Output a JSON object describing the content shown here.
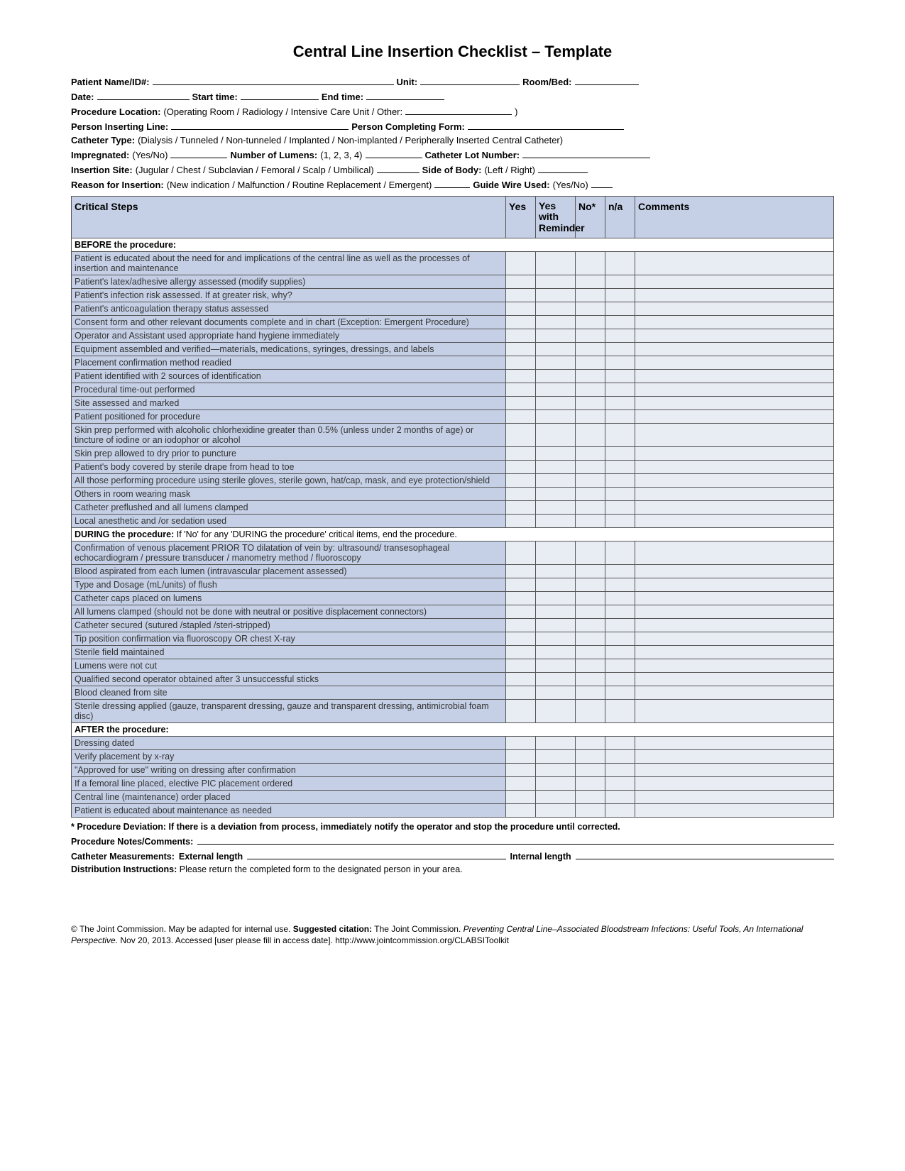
{
  "title": "Central Line Insertion Checklist – Template",
  "info": {
    "patient": "Patient Name/ID#:",
    "unit": "Unit:",
    "roombed": "Room/Bed:",
    "date": "Date:",
    "start": "Start time:",
    "end": "End time:",
    "procloc_label": "Procedure Location:",
    "procloc_paren": "(Operating Room / Radiology / Intensive Care Unit / Other:",
    "procloc_close": ")",
    "person_insert": "Person Inserting Line:",
    "person_form": "Person Completing Form:",
    "cath_type_label": "Catheter Type:",
    "cath_type_paren": "(Dialysis / Tunneled / Non-tunneled / Implanted / Non-implanted / Peripherally Inserted Central Catheter)",
    "impreg_label": "Impregnated:",
    "impreg_paren": "(Yes/No)",
    "numlumens_label": "Number of Lumens:",
    "numlumens_paren": "(1, 2, 3, 4)",
    "lot_label": "Catheter Lot Number:",
    "site_label": "Insertion Site:",
    "site_paren": "(Jugular / Chest / Subclavian / Femoral / Scalp / Umbilical)",
    "side_label": "Side of Body:",
    "side_paren": "(Left / Right)",
    "reason_label": "Reason for Insertion:",
    "reason_paren": "(New indication / Malfunction / Routine Replacement / Emergent)",
    "guidewire_label": "Guide Wire Used:",
    "guidewire_paren": "(Yes/No)"
  },
  "headers": {
    "steps": "Critical Steps",
    "yes": "Yes",
    "yeswr": "Yes with Reminder",
    "no": "No*",
    "na": "n/a",
    "comments": "Comments"
  },
  "sections": [
    {
      "label": "BEFORE the procedure:",
      "subnote": "",
      "items": [
        "Patient is educated about the need for and implications of the central line as well as the processes of insertion and maintenance",
        "Patient's latex/adhesive allergy assessed (modify supplies)",
        "Patient's infection risk assessed. If at greater risk, why?",
        "Patient's anticoagulation therapy status assessed",
        "Consent form and other relevant documents complete and in chart (Exception: Emergent Procedure)",
        "Operator and Assistant used appropriate hand hygiene immediately",
        "Equipment assembled and verified—materials, medications, syringes, dressings, and labels",
        "Placement confirmation method readied",
        "Patient identified with 2 sources of identification",
        "Procedural time-out performed",
        "Site assessed and marked",
        "Patient positioned for procedure",
        "Skin prep performed with alcoholic chlorhexidine greater than 0.5% (unless under 2 months of age) or tincture of iodine or an iodophor or alcohol",
        "Skin prep allowed to dry prior to puncture",
        "Patient's body covered by sterile drape from head to toe",
        "All those performing procedure using sterile gloves, sterile gown, hat/cap, mask, and eye protection/shield",
        "Others in room wearing mask",
        "Catheter preflushed and all lumens clamped",
        "Local anesthetic and /or sedation used"
      ]
    },
    {
      "label": "DURING the procedure:",
      "subnote": "If 'No' for any 'DURING the procedure' critical items, end the procedure.",
      "items": [
        "Confirmation of venous placement PRIOR TO dilatation of vein by: ultrasound/ transesophageal echocardiogram / pressure transducer / manometry method / fluoroscopy",
        "Blood aspirated from each lumen (intravascular placement assessed)",
        "Type and Dosage (mL/units) of flush",
        "Catheter caps placed on lumens",
        "All lumens clamped (should not be done with neutral or positive displacement connectors)",
        "Catheter secured (sutured /stapled /steri-stripped)",
        "Tip position confirmation via fluoroscopy OR chest X-ray",
        "Sterile field maintained",
        "Lumens were not cut",
        "Qualified second operator obtained after 3 unsuccessful sticks",
        "Blood cleaned from site",
        "Sterile dressing applied (gauze, transparent dressing, gauze and transparent dressing, antimicrobial foam disc)"
      ]
    },
    {
      "label": "AFTER the procedure:",
      "subnote": "",
      "items": [
        "Dressing dated",
        "Verify placement by x-ray",
        "\"Approved for use\" writing on dressing after confirmation",
        "If a femoral line placed, elective PIC placement ordered",
        "Central line (maintenance) order placed",
        "Patient is educated about maintenance as needed"
      ]
    }
  ],
  "footnotes": {
    "deviation": "* Procedure Deviation: If there is a deviation from process, immediately notify the operator and stop the procedure until corrected.",
    "notes_label": "Procedure Notes/Comments:",
    "meas_label": "Catheter Measurements:",
    "ext": "External length",
    "int": "Internal length",
    "dist_label": "Distribution Instructions:",
    "dist_text": "Please return the completed form to the designated person in your area."
  },
  "citation": {
    "copyright": "© The Joint Commission. May be adapted for internal use.",
    "suggested": "Suggested citation:",
    "text1": "The Joint Commission.",
    "italic": "Preventing Central Line–Associated Bloodstream Infections: Useful Tools, An International Perspective.",
    "text2": "Nov 20, 2013. Accessed [user please fill in access date]. http://www.jointcommission.org/CLABSIToolkit"
  }
}
